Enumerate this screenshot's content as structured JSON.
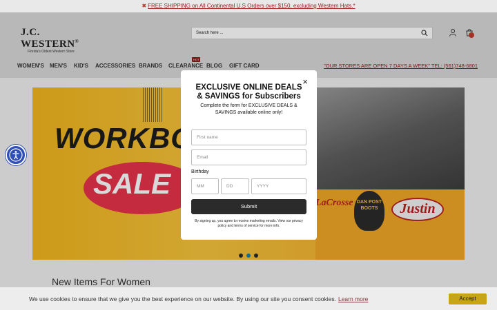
{
  "promo_bar": {
    "icon": "flag-icon",
    "text": "FREE SHIPPING on All Continental U.S Orders over $150, excluding Western Hats.*"
  },
  "header": {
    "logo_name": "J.C. WESTERN",
    "logo_mark": "®",
    "logo_tagline": "Florida's Oldest Western Store",
    "search_placeholder": "Search here ...",
    "icons": [
      "search-icon",
      "user-icon",
      "cart-icon"
    ]
  },
  "nav": {
    "items": [
      "WOMEN'S",
      "MEN'S",
      "KID'S",
      "ACCESSORIES",
      "BRANDS",
      "CLEARANCE",
      "BLOG",
      "GIFT CARD"
    ],
    "hot_badge": "HOT",
    "stores_message": "\"OUR STORES ARE OPEN 7 DAYS A WEEK\" TEL: (561)748-6801"
  },
  "hero": {
    "headline": "WORKBOOTS",
    "sale_text": "SALE",
    "brands": [
      "LaCrosse",
      "DAN POST BOOTS",
      "Justin"
    ],
    "slides": 3,
    "active_slide": 2
  },
  "modal": {
    "title_line1": "EXCLUSIVE ONLINE DEALS",
    "title_line2": "& SAVINGS for Subscribers",
    "subtitle": "Complete the form for EXCLUSIVE DEALS & SAVINGS available online only!",
    "first_name_placeholder": "First name",
    "email_placeholder": "Email",
    "birthday_label": "Birthday",
    "month_placeholder": "MM",
    "day_placeholder": "DD",
    "year_placeholder": "YYYY",
    "submit_label": "Submit",
    "disclaimer": "By signing up, you agree to receive marketing emails. View our privacy policy and terms of service for more info.",
    "close_label": "×"
  },
  "section": {
    "new_items_title": "New Items For Women"
  },
  "cookie_bar": {
    "message": "We use cookies to ensure that we give you the best experience on our website. By using our site you consent cookies.",
    "learn_more": "Learn more",
    "accept_label": "Accept"
  },
  "colors": {
    "accent_red": "#9b1d20",
    "accessibility_blue": "#2f4fb5",
    "accept_gold": "#c8a416",
    "slider_active": "#1a7fa8"
  }
}
